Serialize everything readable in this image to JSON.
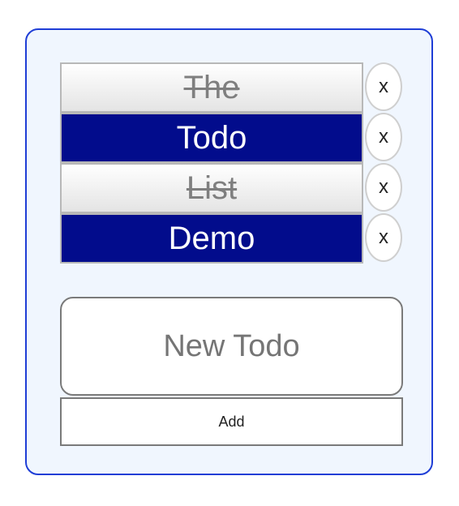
{
  "todos": [
    {
      "label": "The",
      "completed": true
    },
    {
      "label": "Todo",
      "completed": false
    },
    {
      "label": "List",
      "completed": true
    },
    {
      "label": "Demo",
      "completed": false
    }
  ],
  "delete_label": "x",
  "input": {
    "placeholder": "New Todo",
    "value": ""
  },
  "add_label": "Add",
  "colors": {
    "active_bg": "#020c8c",
    "panel_bg": "#f0f6fe",
    "panel_border": "#1f3ed6",
    "done_text": "#7f7f7f"
  }
}
